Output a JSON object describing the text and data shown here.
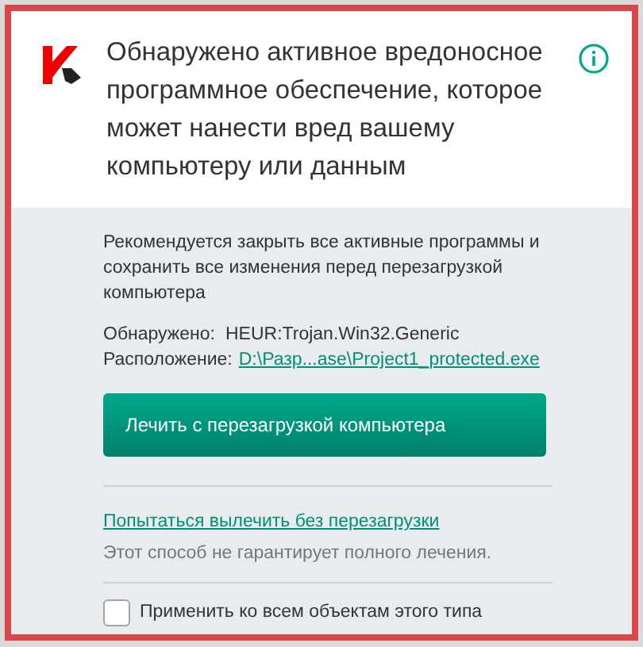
{
  "header": {
    "title": "Обнаружено активное вредоносное программное обеспечение, которое может нанести вред вашему компьютеру или данным"
  },
  "body": {
    "recommendation": "Рекомендуется закрыть все активные программы и сохранить все изменения перед перезагрузкой компьютера",
    "details": [
      {
        "label": "Обнаружено:",
        "value": "HEUR:Trojan.Win32.Generic",
        "kind": "text"
      },
      {
        "label": "Расположение:",
        "value": "D:\\Разр...ase\\Project1_protected.exe",
        "kind": "link"
      }
    ],
    "primary_button": "Лечить с перезагрузкой компьютера",
    "alt_link": "Попытаться вылечить без перезагрузки",
    "alt_note": "Этот способ не гарантирует полного лечения.",
    "apply_all": {
      "label": "Применить ко всем объектам этого типа",
      "checked": false
    }
  }
}
